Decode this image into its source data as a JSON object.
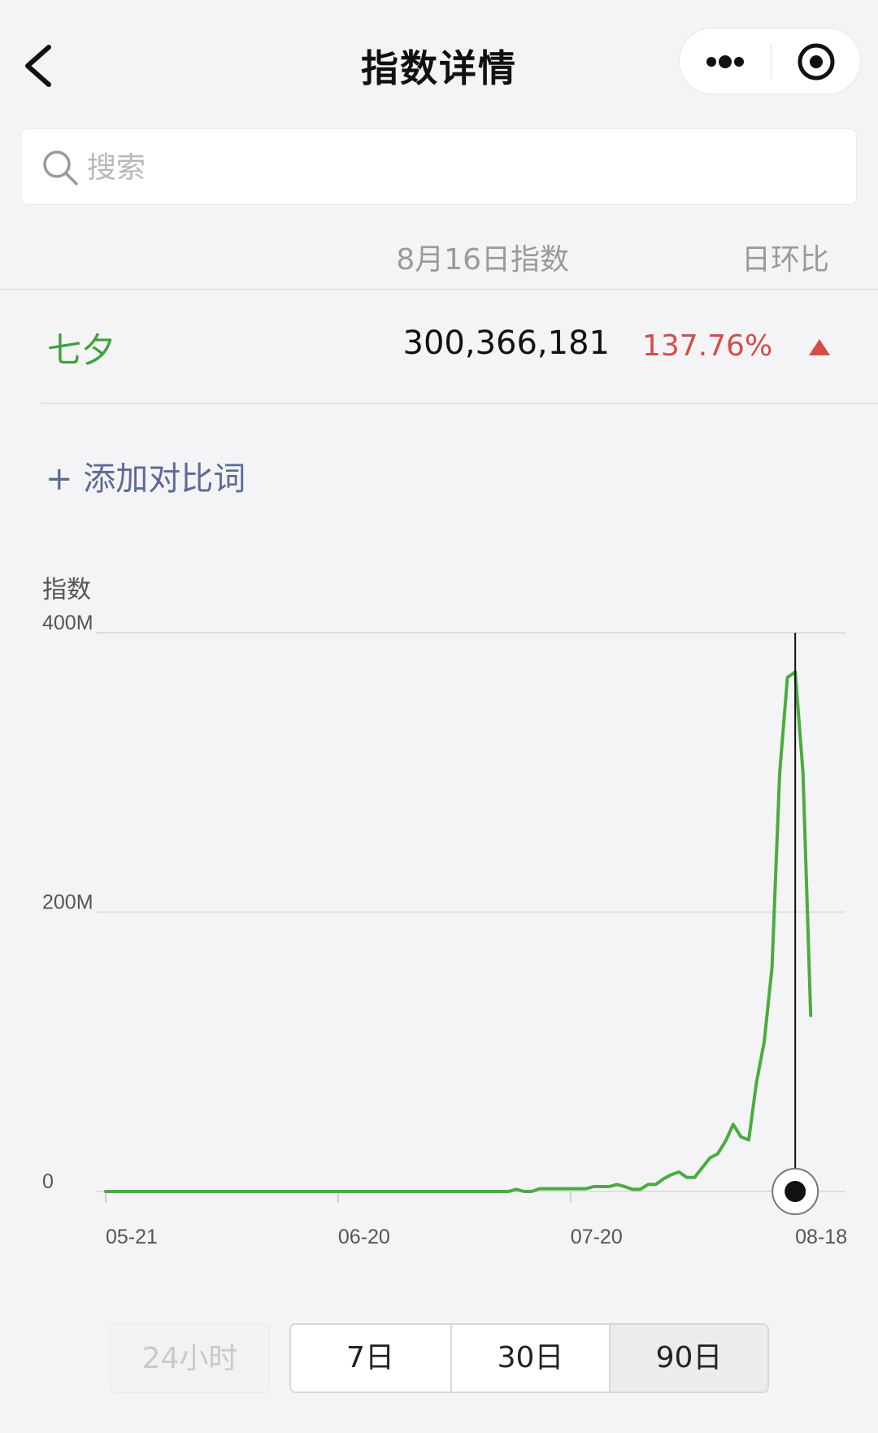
{
  "nav": {
    "title": "指数详情",
    "back_icon": "chevron-left-icon",
    "more_icon": "more-dots-icon",
    "close_icon": "target-close-icon"
  },
  "search": {
    "placeholder": "搜索",
    "value": ""
  },
  "table": {
    "header_date": "8月16日指数",
    "header_ratio": "日环比",
    "rows": [
      {
        "keyword": "七夕",
        "value": "300,366,181",
        "ratio": "137.76%",
        "trend": "up"
      }
    ]
  },
  "add_compare": "+ 添加对比词",
  "colors": {
    "keyword_green": "#3ca23a",
    "ratio_red": "#d44c48",
    "link_blue": "#5e6b96",
    "line_green": "#4aac3f"
  },
  "chart_data": {
    "type": "line",
    "ylabel": "指数",
    "ylim": [
      0,
      400000000
    ],
    "y_ticks": [
      {
        "value": 0,
        "label": "0"
      },
      {
        "value": 200000000,
        "label": "200M"
      },
      {
        "value": 400000000,
        "label": "400M"
      }
    ],
    "x_ticks": [
      {
        "day": 0,
        "label": "05-21"
      },
      {
        "day": 30,
        "label": "06-20"
      },
      {
        "day": 60,
        "label": "07-20"
      },
      {
        "day": 89,
        "label": "08-18"
      }
    ],
    "grid": true,
    "series": [
      {
        "points": [
          [
            0,
            0
          ],
          [
            40,
            0
          ],
          [
            52,
            0
          ],
          [
            53,
            1500000
          ],
          [
            54,
            0
          ],
          [
            55,
            0
          ],
          [
            56,
            2000000
          ],
          [
            60,
            2000000
          ],
          [
            62,
            2000000
          ],
          [
            63,
            3500000
          ],
          [
            65,
            3500000
          ],
          [
            66,
            5000000
          ],
          [
            67,
            3500000
          ],
          [
            68,
            1500000
          ],
          [
            69,
            1500000
          ],
          [
            70,
            5000000
          ],
          [
            71,
            5000000
          ],
          [
            72,
            9000000
          ],
          [
            73,
            12000000
          ],
          [
            74,
            14000000
          ],
          [
            75,
            10000000
          ],
          [
            76,
            10000000
          ],
          [
            77,
            17000000
          ],
          [
            78,
            24000000
          ],
          [
            79,
            27000000
          ],
          [
            80,
            36000000
          ],
          [
            81,
            48000000
          ],
          [
            82,
            39000000
          ],
          [
            83,
            37000000
          ],
          [
            84,
            78000000
          ],
          [
            85,
            107000000
          ],
          [
            86,
            160000000
          ],
          [
            87,
            300000000
          ],
          [
            88,
            368000000
          ],
          [
            89,
            372000000
          ],
          [
            90,
            300000000
          ],
          [
            91,
            126000000
          ]
        ]
      }
    ],
    "selected_point": {
      "day": 89,
      "label": "08-18"
    }
  },
  "range_tabs": [
    {
      "label": "24小时",
      "state": "disabled"
    },
    {
      "label": "7日",
      "state": "normal"
    },
    {
      "label": "30日",
      "state": "normal"
    },
    {
      "label": "90日",
      "state": "selected"
    }
  ]
}
